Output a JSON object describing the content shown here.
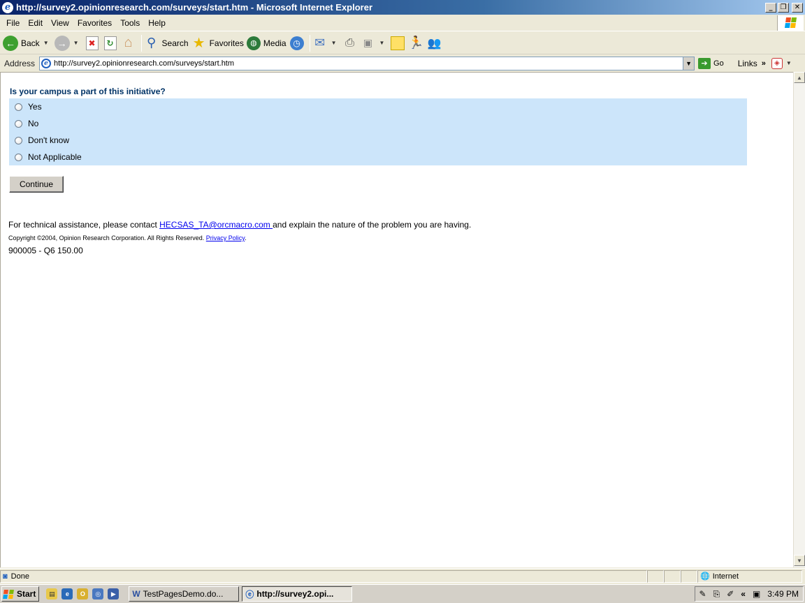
{
  "window": {
    "title": "http://survey2.opinionresearch.com/surveys/start.htm - Microsoft Internet Explorer"
  },
  "menu": [
    "File",
    "Edit",
    "View",
    "Favorites",
    "Tools",
    "Help"
  ],
  "toolbar": {
    "back": "Back",
    "search": "Search",
    "favorites": "Favorites",
    "media": "Media"
  },
  "address": {
    "label": "Address",
    "url": "http://survey2.opinionresearch.com/surveys/start.htm",
    "go": "Go",
    "links": "Links"
  },
  "survey": {
    "question": "Is your campus a part of this initiative?",
    "options": [
      "Yes",
      "No",
      "Don't know",
      "Not Applicable"
    ],
    "continue": "Continue",
    "assist_pre": "For technical assistance, please contact ",
    "assist_email": "HECSAS_TA@orcmacro.com ",
    "assist_post": " and explain the nature of the problem you are having.",
    "copyright": "Copyright ©2004, Opinion Research Corporation. All Rights Reserved. ",
    "privacy": "Privacy Policy",
    "copyright_end": ".",
    "code": "900005 - Q6 150.00"
  },
  "status": {
    "text": "Done",
    "zone": "Internet"
  },
  "taskbar": {
    "start": "Start",
    "tasks": [
      "TestPagesDemo.do...",
      "http://survey2.opi..."
    ],
    "clock": "3:49 PM"
  }
}
